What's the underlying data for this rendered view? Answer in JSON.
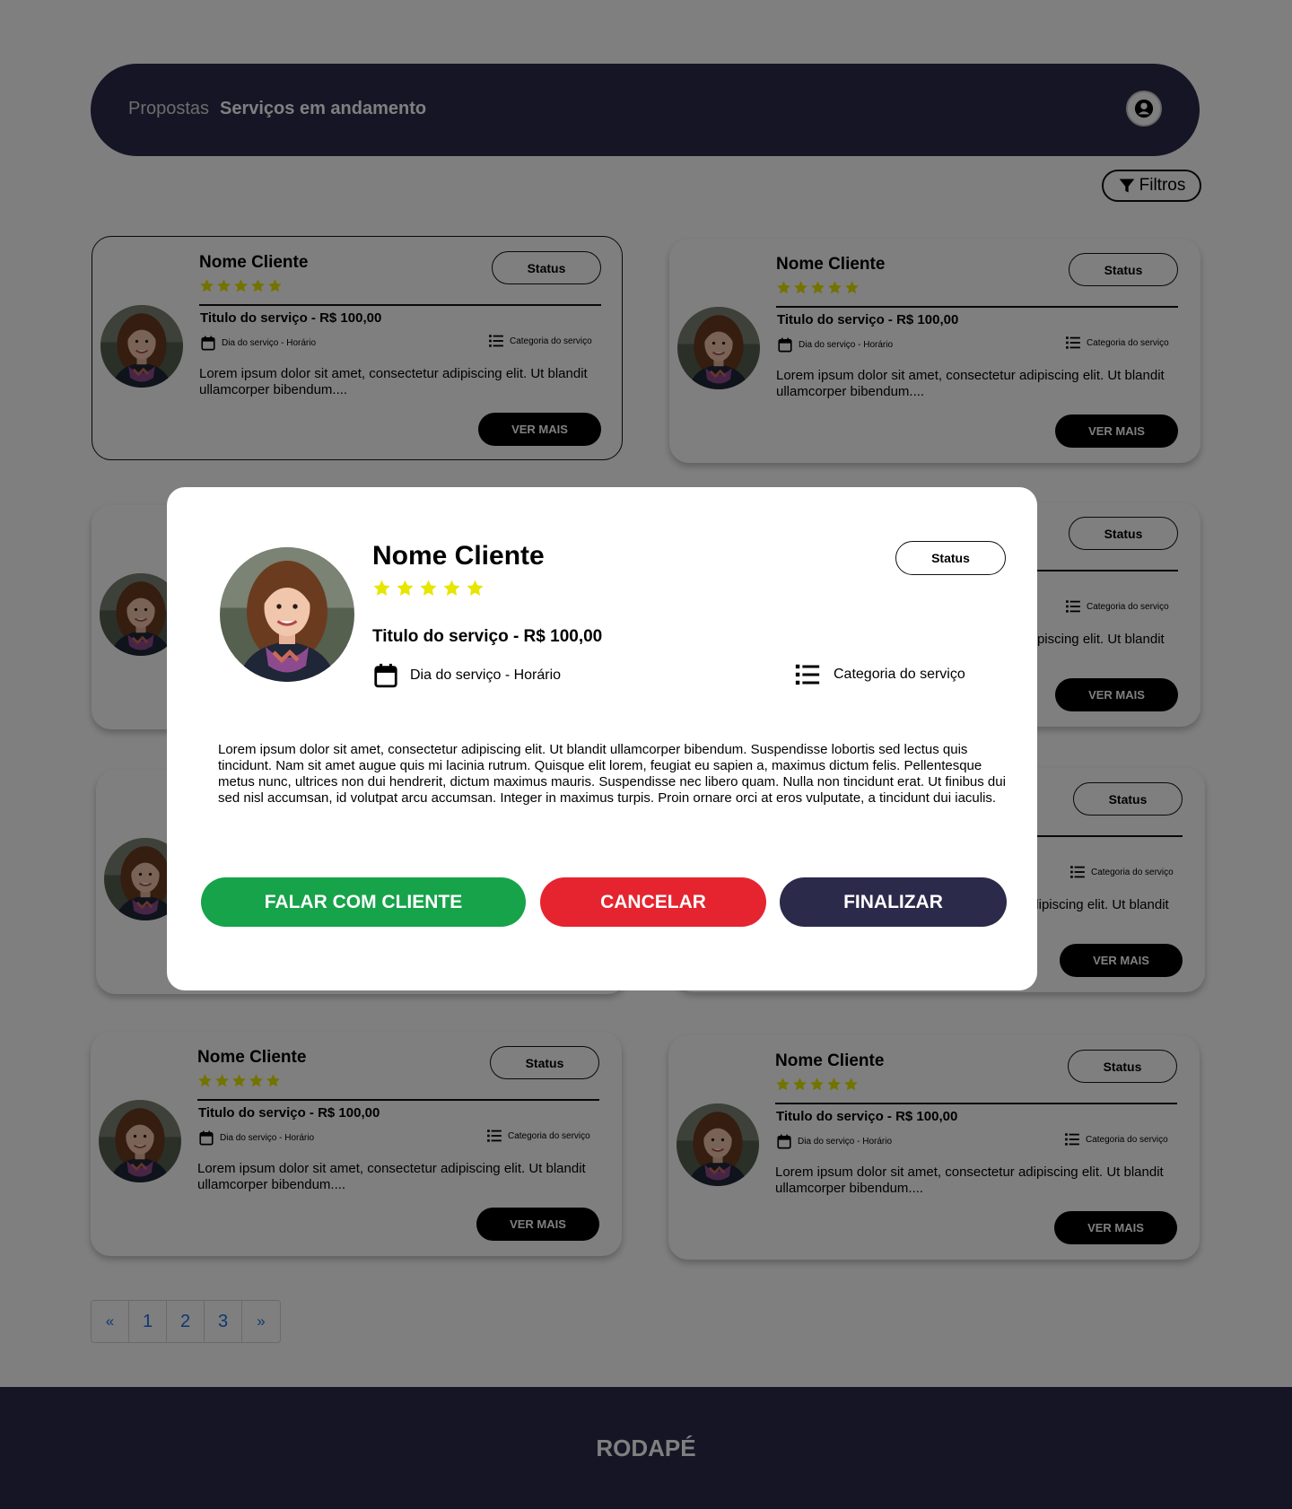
{
  "header": {
    "nav": [
      "Propostas",
      "Serviços em andamento"
    ],
    "profile_icon": "user-icon"
  },
  "filters": {
    "label": "Filtros",
    "icon": "filter-icon"
  },
  "card": {
    "name": "Nome Cliente",
    "rating": 5,
    "status": "Status",
    "title": "Titulo do serviço - R$ 100,00",
    "date": "Dia do serviço - Horário",
    "category": "Categoria do serviço",
    "description": "Lorem ipsum dolor sit amet, consectetur adipiscing elit. Ut blandit ullamcorper bibendum....",
    "more": "VER MAIS"
  },
  "modal": {
    "name": "Nome Cliente",
    "rating": 5,
    "status": "Status",
    "title": "Titulo do serviço - R$ 100,00",
    "date": "Dia do serviço - Horário",
    "category": "Categoria do serviço",
    "description": "Lorem ipsum dolor sit amet, consectetur adipiscing elit. Ut blandit ullamcorper bibendum. Suspendisse lobortis sed lectus quis tincidunt. Nam sit amet augue quis mi lacinia rutrum. Quisque elit lorem, feugiat eu sapien a, maximus dictum felis. Pellentesque metus nunc, ultrices non dui hendrerit, dictum maximus mauris. Suspendisse nec libero quam. Nulla non tincidunt erat. Ut finibus dui sed nisl accumsan, id volutpat arcu accumsan. Integer in maximus turpis. Proin ornare orci at eros vulputate, a tincidunt dui iaculis.",
    "buttons": {
      "talk": "FALAR COM CLIENTE",
      "cancel": "CANCELAR",
      "finish": "FINALIZAR"
    },
    "colors": {
      "talk": "#16a34a",
      "cancel": "#e5242f",
      "finish": "#2c2a4a"
    }
  },
  "pagination": {
    "prev": "«",
    "pages": [
      "1",
      "2",
      "3"
    ],
    "next": "»"
  },
  "footer": {
    "text": "RODAPÉ"
  },
  "colors": {
    "brand": "#2c2a4a",
    "star": "#e6e600",
    "link": "#1f6fe0"
  }
}
